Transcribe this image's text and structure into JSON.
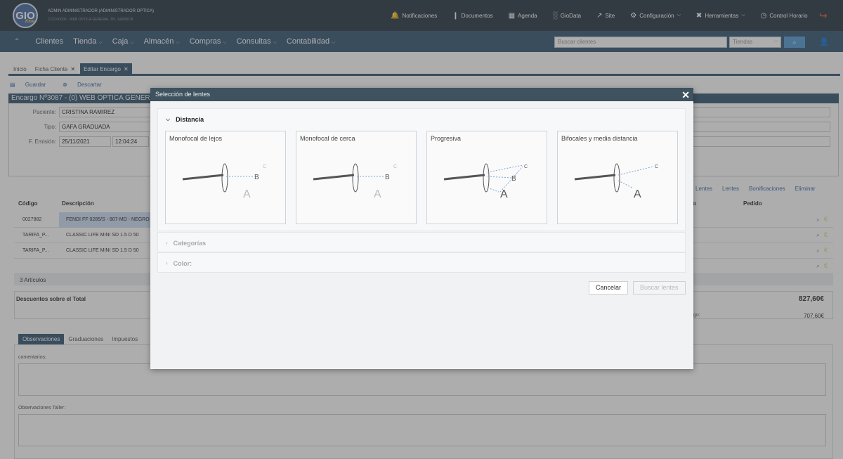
{
  "header": {
    "logo": "GIO",
    "logo_sub": "Kloe",
    "user_line1": "ADMIN ADMINISTRADOR (ADMINISTRADOR OPTICA)",
    "user_line2": "CCD-00000 - WEB OPTICA GENERAL-TB- JURIDICA",
    "menu": [
      {
        "icon": "bell-icon",
        "glyph": "🔔",
        "label": "Notificaciones"
      },
      {
        "icon": "document-icon",
        "glyph": "📄",
        "label": "Documentos"
      },
      {
        "icon": "calendar-icon",
        "glyph": "📅",
        "label": "Agenda"
      },
      {
        "icon": "chart-icon",
        "glyph": "📊",
        "label": "GioData"
      },
      {
        "icon": "external-link-icon",
        "glyph": "↗",
        "label": "Site"
      },
      {
        "icon": "gear-icon",
        "glyph": "⚙",
        "label": "Configuración"
      },
      {
        "icon": "tools-icon",
        "glyph": "✂",
        "label": "Herramientas"
      },
      {
        "icon": "clock-icon",
        "glyph": "◷",
        "label": "Control Horario"
      }
    ]
  },
  "nav": {
    "items": [
      "Clientes",
      "Tienda",
      "Caja",
      "Almacén",
      "Compras",
      "Consultas",
      "Contabilidad"
    ],
    "search_placeholder": "Buscar clientes",
    "store_select": "Tiendas"
  },
  "tabs": [
    {
      "label": "Inicio",
      "closable": false
    },
    {
      "label": "Ficha Cliente",
      "closable": true
    },
    {
      "label": "Editar Encargo",
      "closable": true,
      "active": true
    }
  ],
  "toolbar": {
    "save": "Guardar",
    "discard": "Descartar"
  },
  "form": {
    "title": "Encargo Nº3087  - (0) WEB OPTICA GENERAL",
    "paciente_label": "Paciente:",
    "paciente": "CRISTINA RAMIREZ",
    "tipo_label": "Tipo:",
    "tipo": "GAFA GRADUADA",
    "emision_label": "F. Emisión:",
    "fecha": "25/11/2021",
    "hora": "12:04:24"
  },
  "actions": [
    "Lentes",
    "Lentes",
    "Bonificaciones",
    "Eliminar"
  ],
  "grid": {
    "headers": {
      "codigo": "Código",
      "descripcion": "Descripción",
      "right1": "o",
      "pedido": "Pedido"
    },
    "rows": [
      {
        "codigo": "0027882",
        "descripcion": "FENDI FF 0285/S - 807-MD - NEGRO"
      },
      {
        "codigo": "TARIFA_P...",
        "descripcion": "CLASSIC LIFE MINI SD 1.5 D 50"
      },
      {
        "codigo": "TARIFA_P...",
        "descripcion": "CLASSIC LIFE MINI SD 1.5 D 50"
      }
    ]
  },
  "summary": {
    "articles": "3 Artículos",
    "discount_title": "Descuentos sobre el Total",
    "total": "827,60€",
    "sub_label": "go:",
    "sub_value": "707,60€"
  },
  "bottom_tabs": [
    "Observaciones",
    "Graduaciones",
    "Impuestos"
  ],
  "bottom": {
    "comentarios": "comentarios:",
    "taller": "Observaciones Taller:"
  },
  "modal": {
    "title": "Selección de lentes",
    "section_distancia": "Distancia",
    "lens_types": [
      {
        "label": "Monofocal de lejos",
        "letters": [
          "A",
          "B",
          "C"
        ]
      },
      {
        "label": "Monofocal de cerca",
        "letters": [
          "A",
          "B",
          "C"
        ]
      },
      {
        "label": "Progresiva",
        "letters": [
          "A",
          "B",
          "C"
        ]
      },
      {
        "label": "Bifocales y media distancia",
        "letters": [
          "A",
          "C"
        ]
      }
    ],
    "section_categorias": "Categorías",
    "section_color": "Color:",
    "cancel": "Cancelar",
    "search": "Buscar lentes"
  }
}
